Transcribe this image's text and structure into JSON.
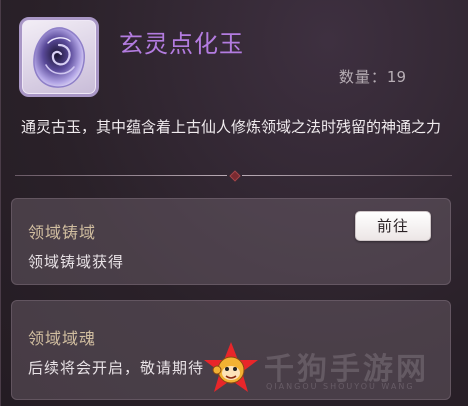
{
  "item": {
    "name": "玄灵点化玉",
    "quantity_label": "数量：",
    "quantity": "19",
    "description": "通灵古玉，其中蕴含着上古仙人修炼领域之法时残留的神通之力",
    "icon": "jade-stone-icon"
  },
  "sources": [
    {
      "title": "领域铸域",
      "text": "领域铸域获得",
      "button_label": "前往"
    },
    {
      "title": "领域域魂",
      "text": "后续将会开启，敬请期待"
    }
  ],
  "watermark": {
    "text": "千狗手游网",
    "subtext": "QIANGOU SHOUYOU WANG",
    "logo": "monkey-star-logo"
  },
  "colors": {
    "title": "#b37ce0",
    "card_title": "#d1bea0",
    "background": "#2a2129"
  }
}
